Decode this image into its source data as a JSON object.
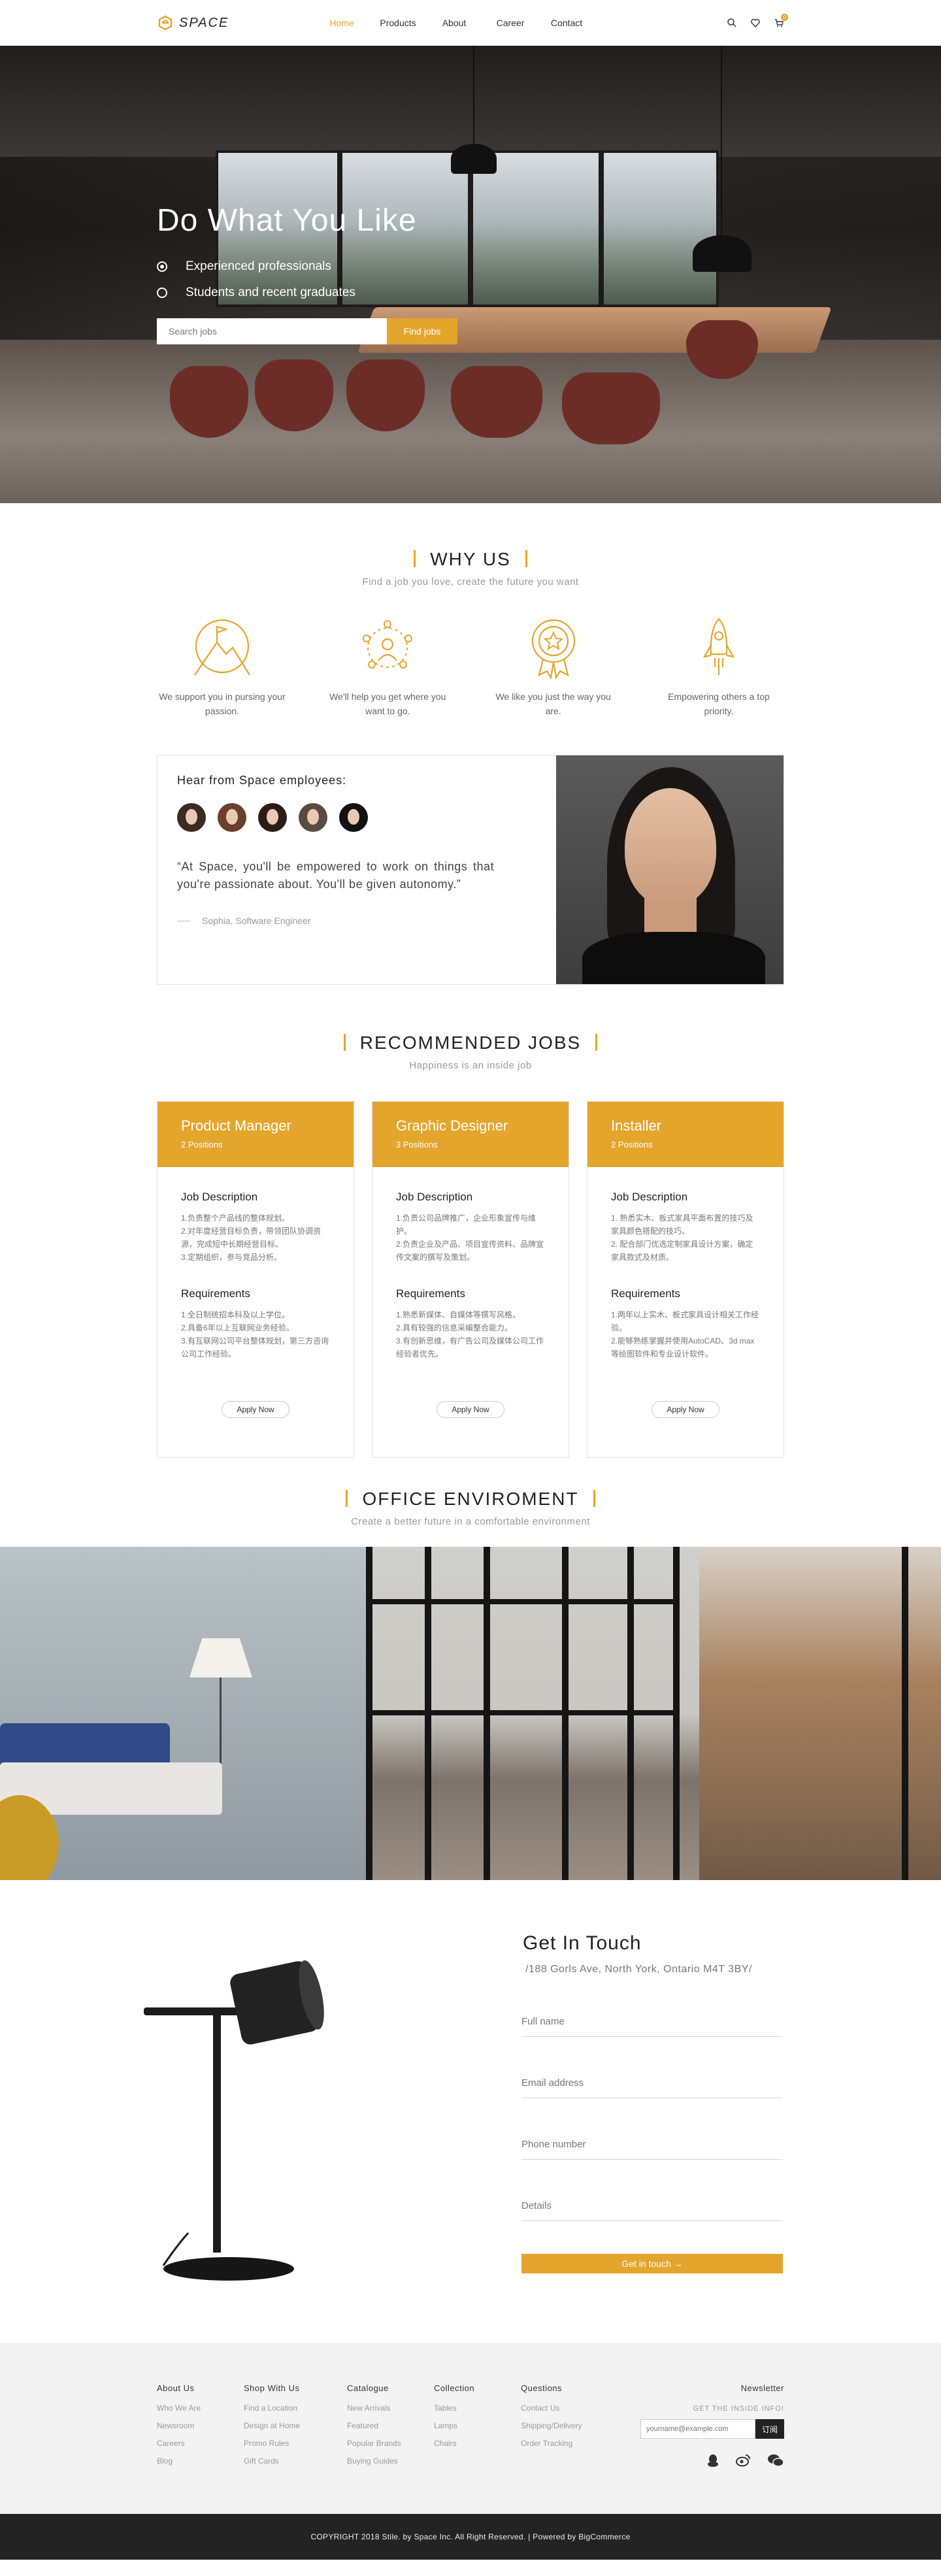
{
  "header": {
    "logo_text": "SPACE",
    "nav": [
      "Home",
      "Products",
      "About",
      "Career",
      "Contact"
    ],
    "active": "Home",
    "icons": [
      "search-icon",
      "heart-icon",
      "cart-icon"
    ],
    "cart_count": "0",
    "accent": "#e3a52b"
  },
  "hero": {
    "title": "Do What You Like",
    "options": [
      {
        "label": "Experienced professionals",
        "selected": true
      },
      {
        "label": "Students and recent graduates",
        "selected": false
      }
    ],
    "search_placeholder": "Search jobs",
    "search_button": "Find jobs"
  },
  "why": {
    "title": "WHY US",
    "subtitle": "Find a job you love, create the future you want",
    "items": [
      {
        "icon": "mountain-flag-icon",
        "text": "We support you in pursing your passion."
      },
      {
        "icon": "team-network-icon",
        "text": "We'll help you get where you want to go."
      },
      {
        "icon": "award-medal-icon",
        "text": "We like you just the way you are."
      },
      {
        "icon": "rocket-icon",
        "text": "Empowering others a top priority."
      }
    ]
  },
  "testimonial": {
    "heading": "Hear from Space employees:",
    "quote": "“At Space, you'll be empowered to work on things that you're passionate about. You'll be given autonomy.”",
    "author": "Sophia, Software Engineer"
  },
  "jobs": {
    "title": "RECOMMENDED JOBS",
    "subtitle": "Happiness is an inside job",
    "desc_label": "Job Description",
    "req_label": "Requirements",
    "apply_label": "Apply Now",
    "cards": [
      {
        "title": "Product Manager",
        "positions": "2 Positions",
        "description": "1.负责整个产品线的整体规划。\n2.对年度经营目标负责，带领团队协调资源，完成短中长期经营目标。\n3.定期组织，参与竞品分析。",
        "requirements": "1.全日制统招本科及以上学位。\n2.具备6年以上互联网业务经验。\n3.有互联网公司平台整体规划，第三方咨询公司工作经验。"
      },
      {
        "title": "Graphic Designer",
        "positions": "3 Positions",
        "description": "1.负责公司品牌推广，企业形象宣传与维护。\n2.负责企业及产品、项目宣传资料、品牌宣传文案的撰写及策划。",
        "requirements": "1.熟悉新媒体、自媒体等撰写风格。\n2.具有较强的信息采编整合能力。\n3.有创新思维，有广告公司及媒体公司工作经验者优先。"
      },
      {
        "title": "Installer",
        "positions": "2 Positions",
        "description": "1. 熟悉实木、板式家具平面布置的技巧及家具颜色搭配的技巧。\n2. 配合部门优选定制家具设计方案，确定家具款式及材质。",
        "requirements": "1.两年以上实木、板式家具设计相关工作经验。\n2.能够熟练掌握并使用AutoCAD、3d max等绘图软件和专业设计软件。"
      }
    ]
  },
  "office": {
    "title": "OFFICE ENVIROMENT",
    "subtitle": "Create a better future in a comfortable environment"
  },
  "contact": {
    "title": "Get In Touch",
    "address": "/188 Gorls Ave, North York, Ontario M4T 3BY/",
    "fields": [
      "Full name",
      "Email address",
      "Phone number",
      "Details"
    ],
    "button": "Get in touch →"
  },
  "footer": {
    "columns": [
      {
        "title": "About Us",
        "links": [
          "Who We Are",
          "Newsroom",
          "Careers",
          "Blog"
        ]
      },
      {
        "title": "Shop With Us",
        "links": [
          "Find a Location",
          "Design at Home",
          "Promo Rules",
          "Gift Cards"
        ]
      },
      {
        "title": "Catalogue",
        "links": [
          "New Arrivals",
          "Featured",
          "Popular Brands",
          "Buying Guides"
        ]
      },
      {
        "title": "Collection",
        "links": [
          "Tables",
          "Lamps",
          "Chairs"
        ]
      },
      {
        "title": "Questions",
        "links": [
          "Contact Us",
          "Shipping/Delivery",
          "Order Tracking"
        ]
      }
    ],
    "newsletter_title": "Newsletter",
    "newsletter_sub": "GET THE INSIDE INFO!",
    "newsletter_placeholder": "yourname@example.com",
    "newsletter_button": "订阅",
    "social": [
      "qq-icon",
      "weibo-icon",
      "wechat-icon"
    ],
    "copyright": "COPYRIGHT 2018 Stile. by Space Inc. All Right Reserved. | Powered by BigCommerce"
  }
}
